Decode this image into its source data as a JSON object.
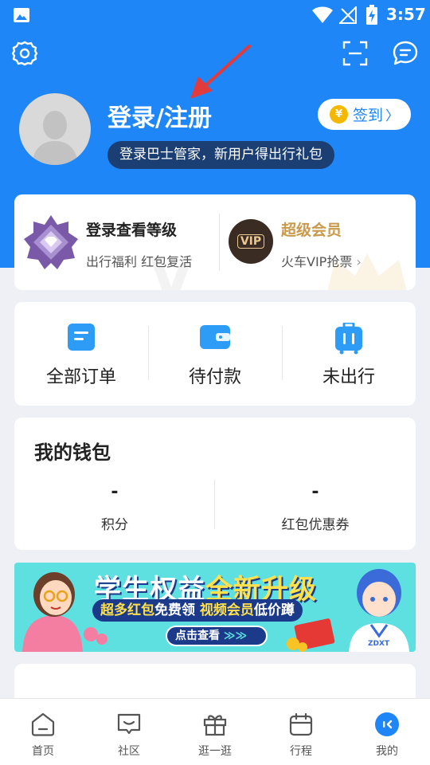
{
  "status_bar": {
    "time": "3:57"
  },
  "header": {
    "login_title": "登录/注册",
    "login_subtitle": "登录巴士管家，新用户得出行礼包",
    "sign_in_label": "签到",
    "coin_symbol": "¥"
  },
  "level_card": {
    "title": "登录查看等级",
    "subtitle": "出行福利  红包复活",
    "vip_badge": "VIP",
    "vip_title": "超级会员",
    "vip_subtitle": "火车VIP抢票",
    "vip_chevron": "›"
  },
  "orders": [
    {
      "label": "全部订单"
    },
    {
      "label": "待付款"
    },
    {
      "label": "未出行"
    }
  ],
  "wallet": {
    "title": "我的钱包",
    "items": [
      {
        "value": "-",
        "label": "积分"
      },
      {
        "value": "-",
        "label": "红包优惠券"
      }
    ]
  },
  "banner": {
    "title_part1": "学生权益",
    "title_part2": "全新升级",
    "sub_part1": "超多红包",
    "sub_part2": "免费领",
    "sub_part3": " 视频会员",
    "sub_part4": "低价蹲",
    "button_label": "点击查看",
    "button_arrows": "≫≫",
    "shirt_text": "ZDXT"
  },
  "bottom_nav": [
    {
      "label": "首页",
      "icon": "home-icon"
    },
    {
      "label": "社区",
      "icon": "community-icon"
    },
    {
      "label": "逛一逛",
      "icon": "gift-icon"
    },
    {
      "label": "行程",
      "icon": "trip-icon"
    },
    {
      "label": "我的",
      "icon": "profile-icon"
    }
  ],
  "colors": {
    "brand_blue": "#1f86f7",
    "vip_gold": "#c99a4b",
    "banner_cyan": "#5fe0e0",
    "annotation_red": "#e23b3b"
  }
}
